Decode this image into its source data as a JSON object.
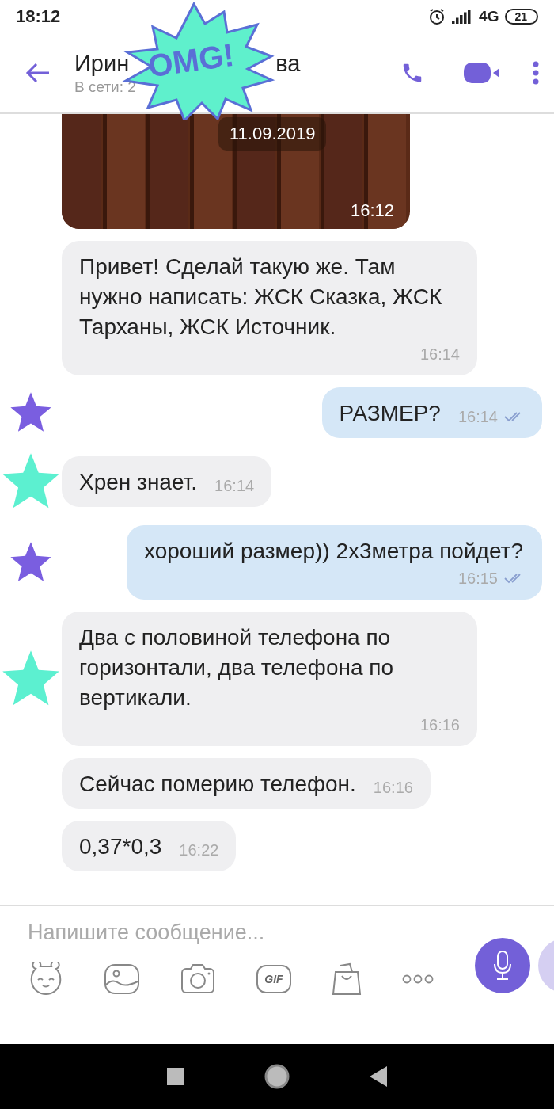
{
  "status_bar": {
    "time": "18:12",
    "network": "4G",
    "battery": "21"
  },
  "header": {
    "title_start": "Ирин",
    "title_end": "ва",
    "status": "В сети: 2"
  },
  "sticker": {
    "text": "OMG!"
  },
  "messages": [
    {
      "date": "11.09.2019",
      "time": "16:12"
    },
    {
      "kind": "incoming",
      "text": "Привет! Сделай такую же. Там нужно написать: ЖСК Сказка, ЖСК Тарханы, ЖСК  Источник.",
      "time": "16:14"
    },
    {
      "kind": "outgoing",
      "text": "РАЗМЕР?",
      "time": "16:14",
      "read": true,
      "color": "#7a5ee0"
    },
    {
      "kind": "incoming",
      "text": "Хрен знает.",
      "time": "16:14",
      "color": "#5cf0d0"
    },
    {
      "kind": "outgoing",
      "text": "хороший размер)) 2х3метра пойдет?",
      "time": "16:15",
      "read": true,
      "color": "#7a5ee0"
    },
    {
      "kind": "incoming",
      "text": "Два с половиной телефона по горизонтали,  два телефона по вертикали.",
      "time": "16:16",
      "color": "#5cf0d0"
    },
    {
      "kind": "incoming",
      "text": "Сейчас померию телефон.",
      "time": "16:16"
    },
    {
      "kind": "incoming",
      "text": "0,37*0,3",
      "time": "16:22"
    }
  ],
  "composer": {
    "placeholder": "Напишите сообщение...",
    "gif_label": "GIF"
  }
}
